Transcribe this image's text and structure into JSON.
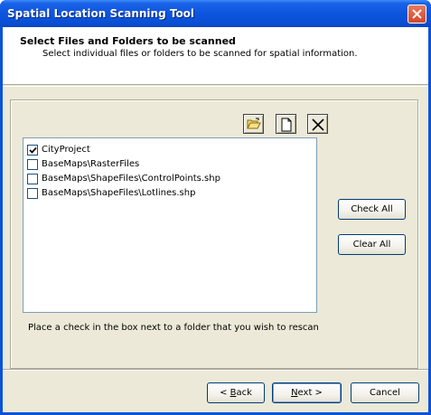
{
  "window": {
    "title": "Spatial Location Scanning Tool"
  },
  "header": {
    "title": "Select Files and Folders to be scanned",
    "description": "Select individual files or folders to be scanned for spatial information."
  },
  "toolbar": {
    "icons": [
      "open-folder-icon",
      "new-file-icon",
      "delete-icon"
    ]
  },
  "list": {
    "items": [
      {
        "label": "CityProject",
        "checked": true
      },
      {
        "label": "BaseMaps\\RasterFiles",
        "checked": false
      },
      {
        "label": "BaseMaps\\ShapeFiles\\ControlPoints.shp",
        "checked": false
      },
      {
        "label": "BaseMaps\\ShapeFiles\\Lotlines.shp",
        "checked": false
      }
    ]
  },
  "actions": {
    "check_all": "Check All",
    "clear_all": "Clear All"
  },
  "hint": "Place a check in the box next to a folder that you wish to rescan",
  "nav": {
    "back_prefix": "< ",
    "back_mnemonic": "B",
    "back_rest": "ack",
    "next_mnemonic": "N",
    "next_rest": "ext >",
    "cancel": "Cancel"
  },
  "colors": {
    "titlebar": "#0a4fd4",
    "dialog_face": "#ece9d8",
    "close_button": "#d5462a"
  }
}
